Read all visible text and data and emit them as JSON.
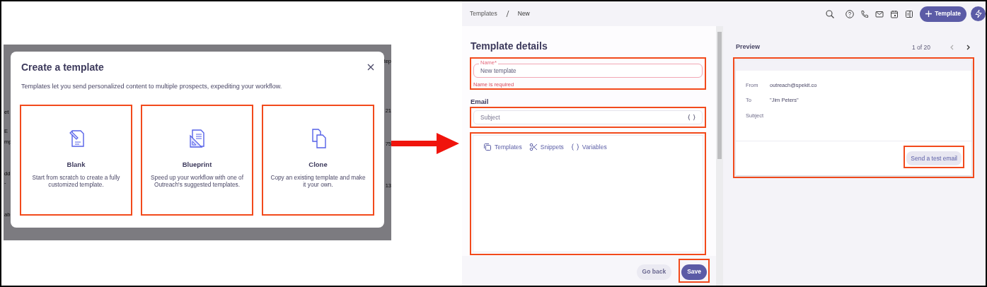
{
  "left_screen": {
    "background_left_fragments": [
      "et",
      "E",
      "mp",
      "dd",
      "-",
      "ab"
    ],
    "background_right_fragments": [
      "tep",
      "21",
      "75",
      "13"
    ],
    "modal": {
      "title": "Create a template",
      "description": "Templates let you send personalized content to multiple prospects, expediting your workflow.",
      "options": [
        {
          "kind": "blank",
          "title": "Blank",
          "description": "Start from scratch to create a fully customized template.",
          "highlighted": true
        },
        {
          "kind": "blueprint",
          "title": "Blueprint",
          "description": "Speed up your workflow with one of Outreach's suggested templates.",
          "highlighted": true
        },
        {
          "kind": "clone",
          "title": "Clone",
          "description": "Copy an existing template and make it your own.",
          "highlighted": true
        }
      ]
    }
  },
  "right_screen": {
    "breadcrumb": [
      "Templates",
      "New"
    ],
    "header_button": "Template",
    "form": {
      "title": "Template details",
      "name_field": {
        "label": "Name*",
        "value": "New template",
        "error": "Name is required",
        "highlighted": true
      },
      "email_label": "Email",
      "subject_field": {
        "placeholder": "Subject",
        "highlighted": true
      },
      "editor": {
        "highlighted": true,
        "toolbar": [
          {
            "kind": "templates",
            "label": "Templates"
          },
          {
            "kind": "snippets",
            "label": "Snippets"
          },
          {
            "kind": "variables",
            "label": "Variables"
          }
        ]
      },
      "buttons": [
        {
          "kind": "secondary",
          "label": "Go back",
          "highlighted": false
        },
        {
          "kind": "primary",
          "label": "Save",
          "highlighted": true
        }
      ]
    },
    "preview": {
      "title": "Preview",
      "pager": "1 of 20",
      "highlighted": true,
      "fields": [
        {
          "label": "From",
          "value": "outreach@spekit.co"
        },
        {
          "label": "To",
          "value": "\"Jim Peters\""
        },
        {
          "label": "Subject"
        }
      ],
      "test_button": {
        "label": "Send a test email",
        "highlighted": true
      }
    }
  }
}
